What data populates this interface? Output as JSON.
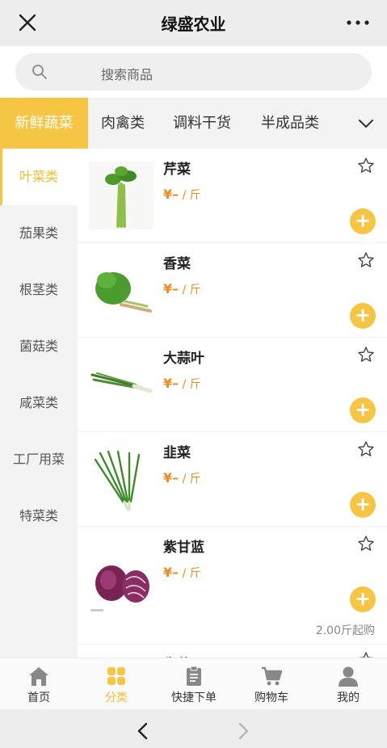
{
  "header": {
    "title": "绿盛农业",
    "close_icon": "close-icon",
    "more_icon": "more-dots-icon"
  },
  "search": {
    "placeholder": "搜索商品"
  },
  "tabs": [
    {
      "label": "新鲜蔬菜",
      "active": true
    },
    {
      "label": "肉禽类",
      "active": false
    },
    {
      "label": "调料干货",
      "active": false
    },
    {
      "label": "半成品类",
      "active": false
    }
  ],
  "sidebar": {
    "items": [
      {
        "label": "叶菜类",
        "active": true
      },
      {
        "label": "茄果类"
      },
      {
        "label": "根茎类"
      },
      {
        "label": "菌菇类"
      },
      {
        "label": "咸菜类"
      },
      {
        "label": "工厂用菜"
      },
      {
        "label": "特菜类"
      }
    ]
  },
  "products": [
    {
      "name": "芹菜",
      "currency": "¥",
      "price": "–",
      "unit": " / 斤"
    },
    {
      "name": "香菜",
      "currency": "¥",
      "price": "–",
      "unit": " / 斤"
    },
    {
      "name": "大蒜叶",
      "currency": "¥",
      "price": "–",
      "unit": " / 斤"
    },
    {
      "name": "韭菜",
      "currency": "¥",
      "price": "–",
      "unit": " / 斤"
    },
    {
      "name": "紫甘蓝",
      "currency": "¥",
      "price": "–",
      "unit": " / 斤",
      "min_buy": "2.00斤起购"
    },
    {
      "name": "生菜"
    }
  ],
  "bottom_nav": [
    {
      "label": "首页",
      "icon": "home-icon"
    },
    {
      "label": "分类",
      "icon": "category-icon",
      "active": true
    },
    {
      "label": "快捷下单",
      "icon": "clipboard-icon"
    },
    {
      "label": "购物车",
      "icon": "cart-icon"
    },
    {
      "label": "我的",
      "icon": "user-icon"
    }
  ],
  "colors": {
    "accent": "#f6c544",
    "price": "#f08a24",
    "background": "#f3f3f3"
  }
}
